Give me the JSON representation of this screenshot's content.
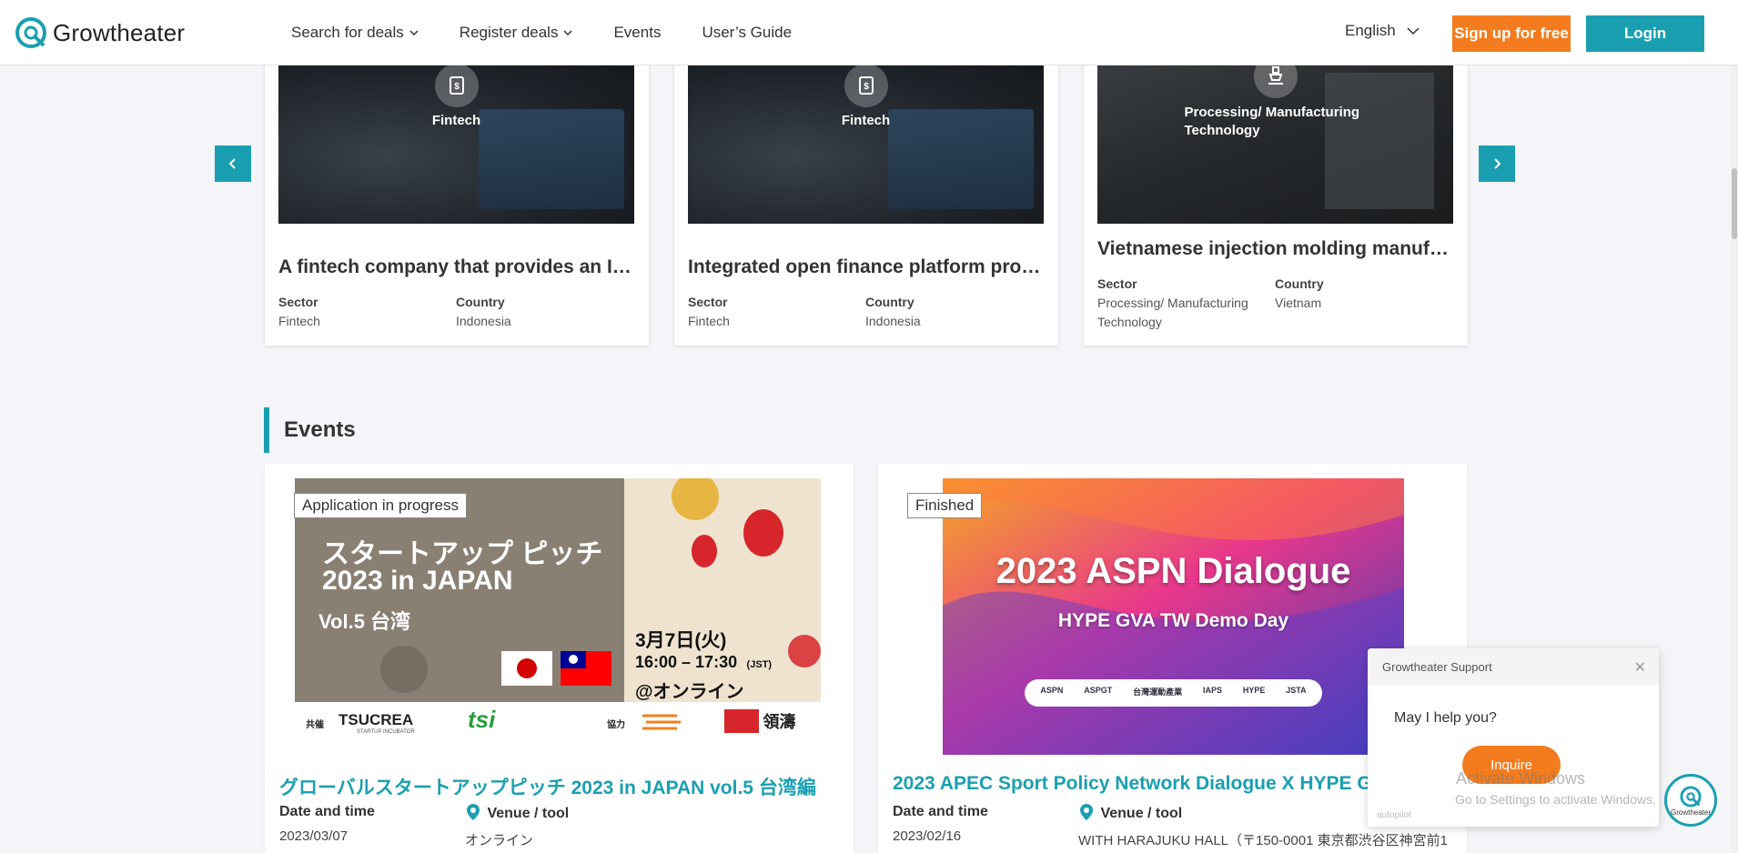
{
  "header": {
    "logo_text": "Growtheater",
    "nav": [
      {
        "label": "Search for deals",
        "dropdown": true
      },
      {
        "label": "Register deals",
        "dropdown": true
      },
      {
        "label": "Events",
        "dropdown": false
      },
      {
        "label": "User’s Guide",
        "dropdown": false
      }
    ],
    "language": "English",
    "signup_label": "Sign up for free",
    "login_label": "Login"
  },
  "deals": [
    {
      "badge": "Fintech",
      "title": "A fintech company that provides an IT…",
      "sector_label": "Sector",
      "sector": "Fintech",
      "country_label": "Country",
      "country": "Indonesia"
    },
    {
      "badge": "Fintech",
      "title": "Integrated open finance platform pro…",
      "sector_label": "Sector",
      "sector": "Fintech",
      "country_label": "Country",
      "country": "Indonesia"
    },
    {
      "badge": "Processing/ Manufacturing Technology",
      "title": "Vietnamese injection molding manuf…",
      "sector_label": "Sector",
      "sector": "Processing/ Manufacturing Technology",
      "country_label": "Country",
      "country": "Vietnam"
    }
  ],
  "events_heading": "Events",
  "events": [
    {
      "status": "Application in progress",
      "banner_line1": "スタートアップ ピッチ",
      "banner_line2": "2023 in JAPAN",
      "banner_line3": "Vol.5 台湾",
      "banner_date": "3月7日(火)",
      "banner_time": "16:00 – 17:30",
      "banner_tz": "(JST)",
      "banner_online": "@オンライン",
      "banner_cohost": "共催",
      "banner_coop": "協力",
      "banner_logo1": "TSUCREA",
      "banner_logo1_sub": "STARTUP INCUBATOR",
      "banner_logo2": "tsi",
      "banner_logo3": "領濤",
      "title": "グローバルスタートアップピッチ 2023 in JAPAN vol.5 台湾編",
      "date_label": "Date and time",
      "date": "2023/03/07",
      "venue_label": "Venue / tool",
      "venue": "オンライン"
    },
    {
      "status": "Finished",
      "banner_title": "2023 ASPN Dialogue",
      "banner_subtitle": "HYPE GVA TW Demo Day",
      "banner_logos": [
        "ASPN",
        "ASPGT",
        "台灣運動產業",
        "IAPS",
        "HYPE",
        "JSTA"
      ],
      "title": "2023 APEC Sport Policy Network Dialogue X HYPE Glo",
      "date_label": "Date and time",
      "date": "2023/02/16",
      "venue_label": "Venue / tool",
      "venue": "WITH HARAJUKU HALL（〒150-0001 東京都渋谷区神宮前1"
    }
  ],
  "support": {
    "title": "Growtheater Support",
    "message": "May I help you?",
    "button": "Inquire",
    "footer": "autopilot",
    "bubble_label": "Growtheater"
  },
  "watermark": {
    "line1": "Activate Windows",
    "line2": "Go to Settings to activate Windows."
  },
  "colors": {
    "accent": "#1a9fb1",
    "orange": "#f47c1e"
  }
}
